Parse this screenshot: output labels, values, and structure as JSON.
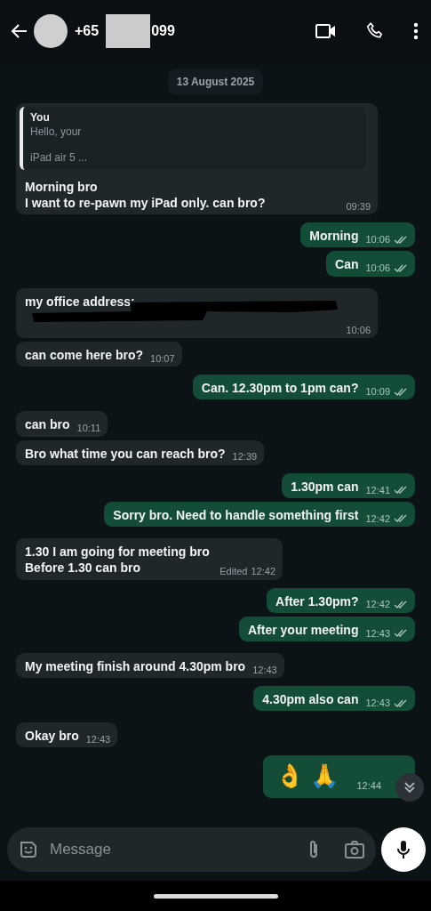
{
  "header": {
    "number_prefix": "+65",
    "number_suffix": "099"
  },
  "date_chip": "13 August 2025",
  "messages": [
    {
      "kind": "in",
      "quote": {
        "author": "You",
        "lines": [
          "Hello, your",
          "iPad air 5 ..."
        ]
      },
      "lines": [
        "Morning bro",
        "I want to re-pawn my iPad only. can bro?"
      ],
      "time": "09:39"
    },
    {
      "kind": "out",
      "lines": [
        "Morning"
      ],
      "time": "10:06",
      "delivered": true
    },
    {
      "kind": "out",
      "lines": [
        "Can"
      ],
      "time": "10:06",
      "delivered": true
    },
    {
      "kind": "in",
      "lines": [
        "my office address:"
      ],
      "redacted": true,
      "time": "10:06"
    },
    {
      "kind": "in",
      "lines": [
        "can come here bro?"
      ],
      "time": "10:07"
    },
    {
      "kind": "out",
      "lines": [
        "Can. 12.30pm to 1pm can?"
      ],
      "time": "10:09",
      "delivered": true
    },
    {
      "kind": "in",
      "lines": [
        "can bro"
      ],
      "time": "10:11"
    },
    {
      "kind": "in",
      "lines": [
        "Bro what time you can reach bro?"
      ],
      "time": "12:39"
    },
    {
      "kind": "out",
      "lines": [
        "1.30pm can"
      ],
      "time": "12:41",
      "delivered": true
    },
    {
      "kind": "out",
      "lines": [
        "Sorry bro. Need to handle something first"
      ],
      "time": "12:42",
      "delivered": true
    },
    {
      "kind": "in",
      "lines": [
        "1.30 I am going for meeting bro",
        "Before 1.30 can bro"
      ],
      "edited": "Edited",
      "time": "12:42"
    },
    {
      "kind": "out",
      "lines": [
        "After 1.30pm?"
      ],
      "time": "12:42",
      "delivered": true
    },
    {
      "kind": "out",
      "lines": [
        "After your meeting"
      ],
      "time": "12:43",
      "delivered": true
    },
    {
      "kind": "in",
      "lines": [
        "My meeting finish around 4.30pm bro"
      ],
      "time": "12:43"
    },
    {
      "kind": "out",
      "lines": [
        "4.30pm also can"
      ],
      "time": "12:43",
      "delivered": true
    },
    {
      "kind": "in",
      "lines": [
        "Okay bro"
      ],
      "time": "12:43"
    },
    {
      "kind": "out",
      "emoji": "👌 🙏",
      "time": "12:44"
    }
  ],
  "composer": {
    "placeholder": "Message"
  }
}
